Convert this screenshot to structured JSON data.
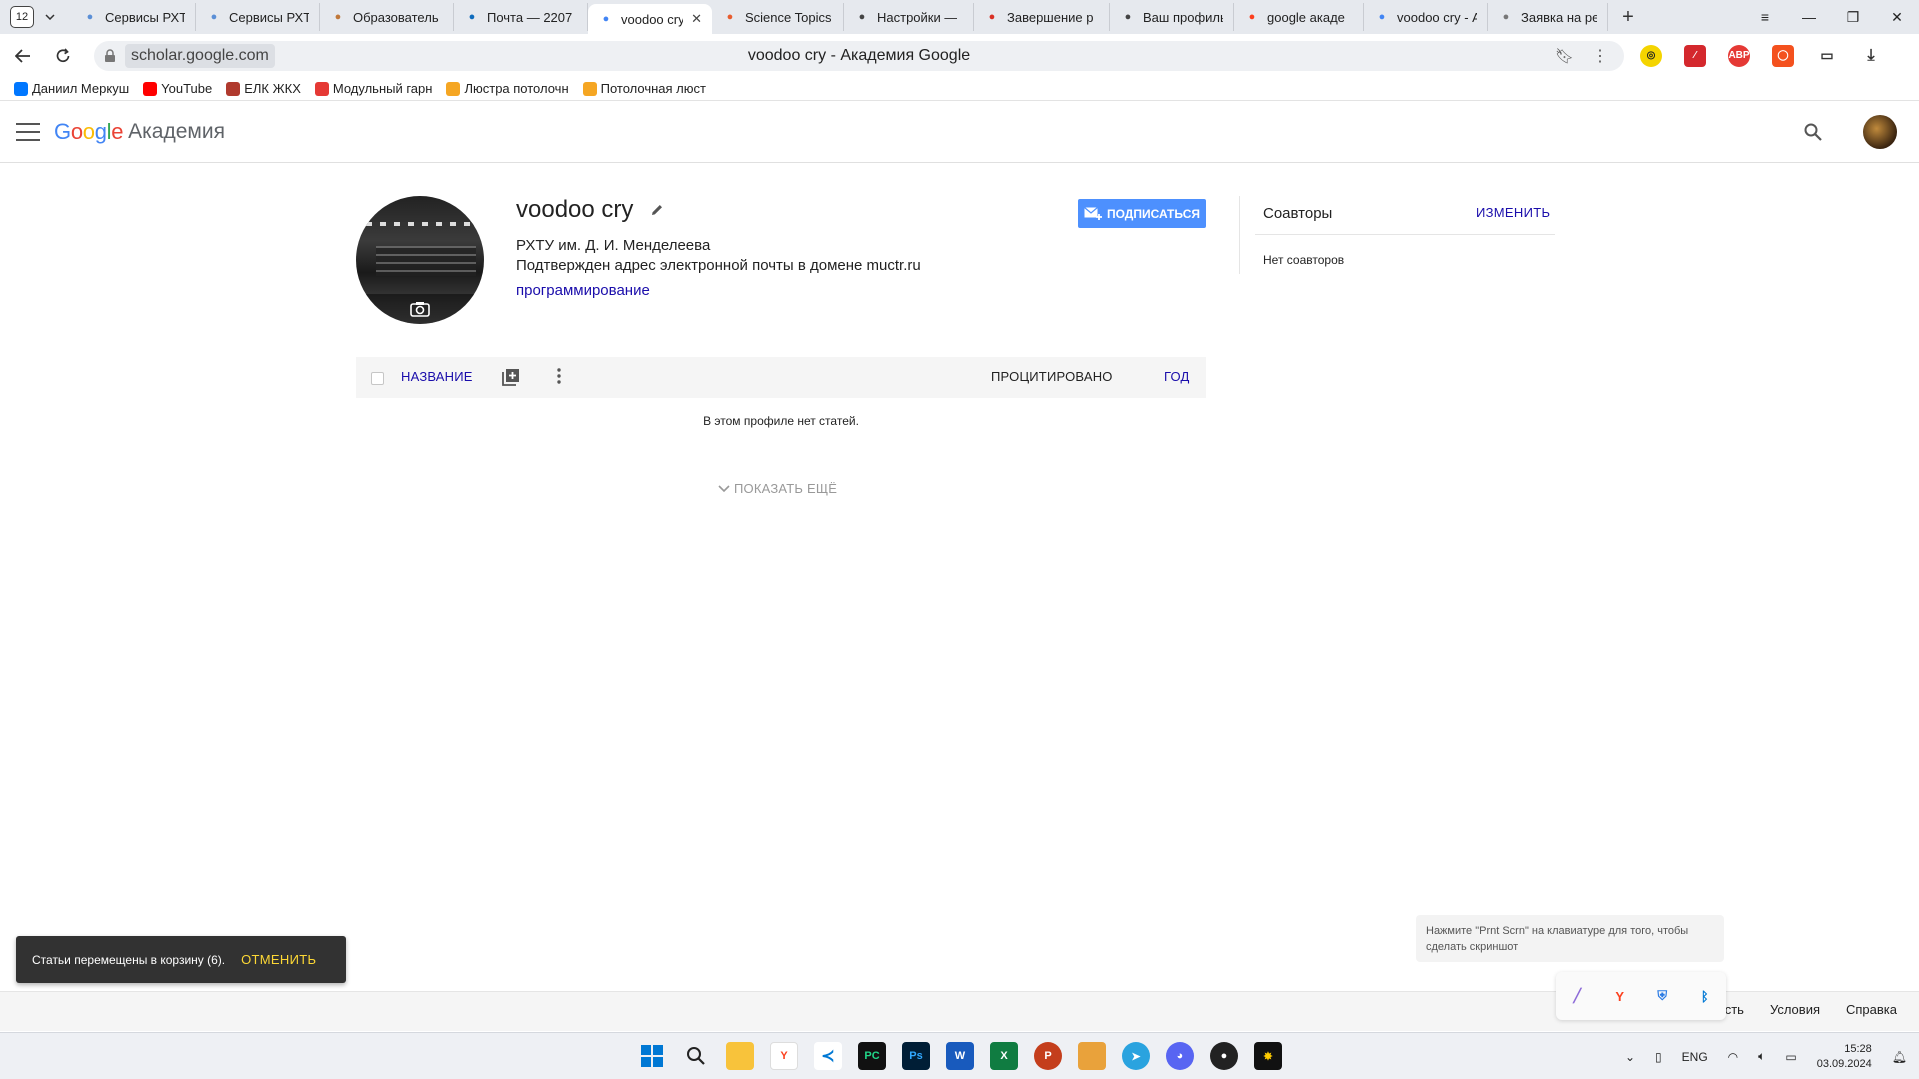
{
  "browser": {
    "tab_count": "12",
    "tabs": [
      {
        "title": "Сервисы РХТУ",
        "icon": "drop-icon",
        "color": "#5b8fd6"
      },
      {
        "title": "Сервисы РХТУ",
        "icon": "drop-icon",
        "color": "#5b8fd6"
      },
      {
        "title": "Образователь",
        "icon": "grid-icon",
        "color": "#c0783a"
      },
      {
        "title": "Почта — 2207",
        "icon": "outlook-icon",
        "color": "#0f6cbd"
      },
      {
        "title": "voodoo cry",
        "icon": "scholar-icon",
        "color": "#4285f4",
        "active": true
      },
      {
        "title": "Science Topics",
        "icon": "e-icon",
        "color": "#e85d2f"
      },
      {
        "title": "Настройки —",
        "icon": "doc-icon",
        "color": "#444"
      },
      {
        "title": "Завершение р",
        "icon": "gmail-icon",
        "color": "#d93025"
      },
      {
        "title": "Ваш профиль",
        "icon": "doc-icon",
        "color": "#444"
      },
      {
        "title": "google акаде",
        "icon": "yandex-icon",
        "color": "#fc3f1d"
      },
      {
        "title": "voodoo cry - А",
        "icon": "scholar-icon",
        "color": "#4285f4"
      },
      {
        "title": "Заявка на рег",
        "icon": "gear-icon",
        "color": "#777"
      }
    ],
    "address_domain": "scholar.google.com",
    "page_title": "voodoo cry - Академия Google",
    "bookmarks": [
      {
        "label": "Даниил Меркуш",
        "icon": "vk-icon",
        "color": "#0077ff"
      },
      {
        "label": "YouTube",
        "icon": "youtube-icon",
        "color": "#ff0000"
      },
      {
        "label": "ЕЛК ЖКХ",
        "icon": "elk-icon",
        "color": "#b03a2e"
      },
      {
        "label": "Модульный гарн",
        "icon": "modul-icon",
        "color": "#e53935"
      },
      {
        "label": "Люстра потолочн",
        "icon": "shop-icon",
        "color": "#f5a623"
      },
      {
        "label": "Потолочная люст",
        "icon": "shop-icon",
        "color": "#f5a623"
      }
    ]
  },
  "scholar": {
    "logo_google": "Google",
    "logo_product": "Академия",
    "profile": {
      "name": "voodoo cry",
      "affiliation": "РХТУ им. Д. И. Менделеева",
      "verified_email": "Подтвержден адрес электронной почты в домене muctr.ru",
      "interest": "программирование"
    },
    "follow_label": "ПОДПИСАТЬСЯ",
    "coauthors": {
      "title": "Соавторы",
      "edit_label": "ИЗМЕНИТЬ",
      "empty_text": "Нет соавторов"
    },
    "table": {
      "col_title": "НАЗВАНИЕ",
      "col_cited": "ПРОЦИТИРОВАНО",
      "col_year": "ГОД",
      "empty_text": "В этом профиле нет статей.",
      "show_more": "ПОКАЗАТЬ ЕЩЁ"
    },
    "footer_links": [
      "ость",
      "Условия",
      "Справка"
    ],
    "snackbar": {
      "message": "Статьи перемещены в корзину (6).",
      "undo_label": "ОТМЕНИТЬ"
    }
  },
  "system": {
    "screenshot_tip": "Нажмите \"Prnt Scrn\" на клавиатуре для того, чтобы сделать скриншот",
    "lang": "ENG",
    "time": "15:28",
    "date": "03.09.2024"
  },
  "colors": {
    "link_blue": "#1a0dab",
    "follow_blue": "#4d90fe",
    "snackbar_bg": "#323232",
    "snackbar_action": "#fdd835"
  }
}
